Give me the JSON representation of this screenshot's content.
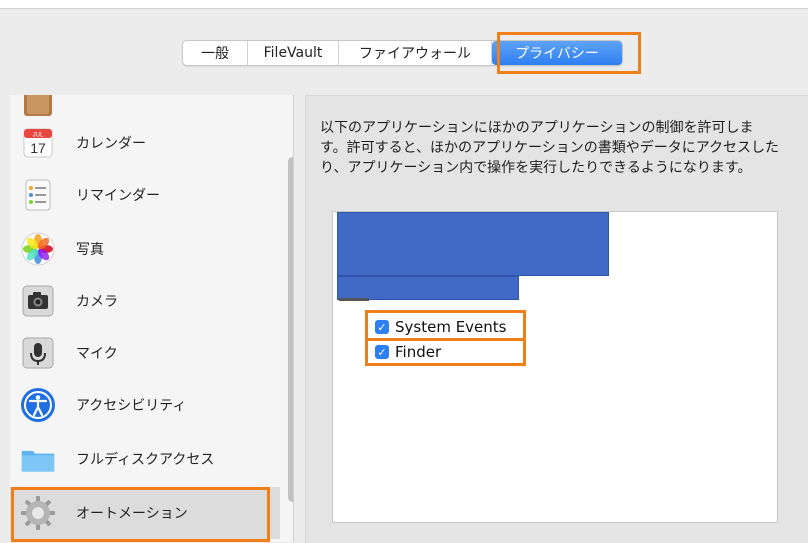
{
  "tabs": [
    {
      "label": "一般"
    },
    {
      "label": "FileVault"
    },
    {
      "label": "ファイアウォール"
    },
    {
      "label": "プライバシー",
      "active": true
    }
  ],
  "sidebar": {
    "items": [
      {
        "label": "",
        "icon": "contacts-icon"
      },
      {
        "label": "カレンダー",
        "icon": "calendar-icon",
        "month": "JUL",
        "day": "17"
      },
      {
        "label": "リマインダー",
        "icon": "reminders-icon"
      },
      {
        "label": "写真",
        "icon": "photos-icon"
      },
      {
        "label": "カメラ",
        "icon": "camera-icon"
      },
      {
        "label": "マイク",
        "icon": "microphone-icon"
      },
      {
        "label": "アクセシビリティ",
        "icon": "accessibility-icon"
      },
      {
        "label": "フルディスクアクセス",
        "icon": "folder-icon"
      },
      {
        "label": "オートメーション",
        "icon": "gear-icon",
        "selected": true
      }
    ]
  },
  "panel": {
    "description": "以下のアプリケーションにほかのアプリケーションの制御を許可します。許可すると、ほかのアプリケーションの書類やデータにアクセスしたり、アプリケーション内で操作を実行したりできるようになります。",
    "permissions": [
      {
        "label": "System Events",
        "checked": true
      },
      {
        "label": "Finder",
        "checked": true
      }
    ]
  },
  "colors": {
    "accent": "#2d7ff2",
    "highlight": "#f07f1a",
    "redaction": "#4169c6"
  }
}
